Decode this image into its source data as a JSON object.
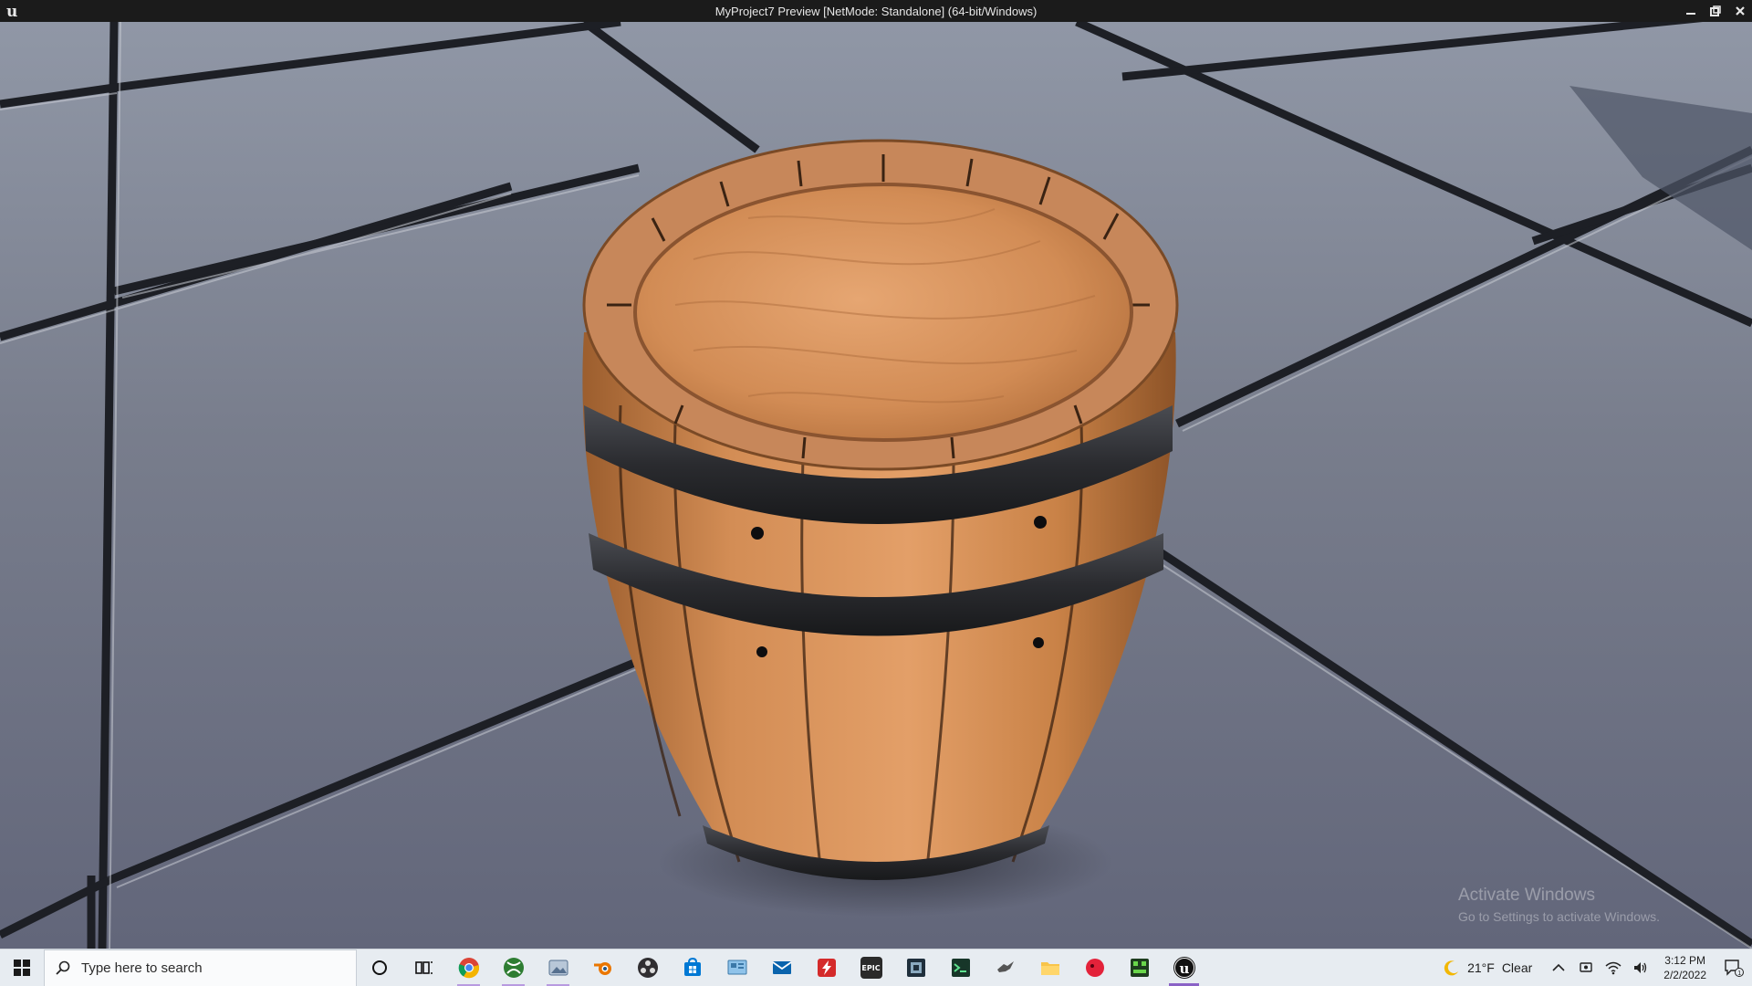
{
  "window": {
    "title": "MyProject7 Preview [NetMode: Standalone]  (64-bit/Windows)",
    "controls": [
      "minimize",
      "restore",
      "close"
    ]
  },
  "viewport": {
    "scene": "wooden barrel on reflective tiled floor",
    "colors": {
      "floor": "#6e7283",
      "grout": "#1c1e24",
      "wood": "#d8935c",
      "band": "#2a2b2e"
    }
  },
  "watermark": {
    "title": "Activate Windows",
    "subtitle": "Go to Settings to activate Windows."
  },
  "taskbar": {
    "search_placeholder": "Type here to search",
    "apps": [
      {
        "name": "cortana-icon",
        "icon": "circle"
      },
      {
        "name": "task-view-icon",
        "icon": "task-view"
      },
      {
        "name": "chrome-icon",
        "icon": "chrome"
      },
      {
        "name": "xbox-icon",
        "icon": "xbox"
      },
      {
        "name": "photos-icon",
        "icon": "photos"
      },
      {
        "name": "blender-icon",
        "icon": "blender"
      },
      {
        "name": "obs-icon",
        "icon": "obs"
      },
      {
        "name": "store-icon",
        "icon": "store"
      },
      {
        "name": "control-panel-icon",
        "icon": "control-panel"
      },
      {
        "name": "mail-icon",
        "icon": "mail"
      },
      {
        "name": "flash-icon",
        "icon": "bolt"
      },
      {
        "name": "epic-games-icon",
        "icon": "epic",
        "label": "EPIC"
      },
      {
        "name": "media-app-icon",
        "icon": "media"
      },
      {
        "name": "terminal-app-icon",
        "icon": "terminal"
      },
      {
        "name": "bird-app-icon",
        "icon": "bird"
      },
      {
        "name": "file-explorer-icon",
        "icon": "folder"
      },
      {
        "name": "red-app-icon",
        "icon": "red-circle"
      },
      {
        "name": "green-app-icon",
        "icon": "green-grid"
      },
      {
        "name": "unreal-engine-icon",
        "icon": "unreal"
      }
    ],
    "weather": {
      "temp": "21°F",
      "condition": "Clear"
    },
    "clock": {
      "time": "3:12 PM",
      "date": "2/2/2022"
    },
    "notification_count": "1"
  }
}
